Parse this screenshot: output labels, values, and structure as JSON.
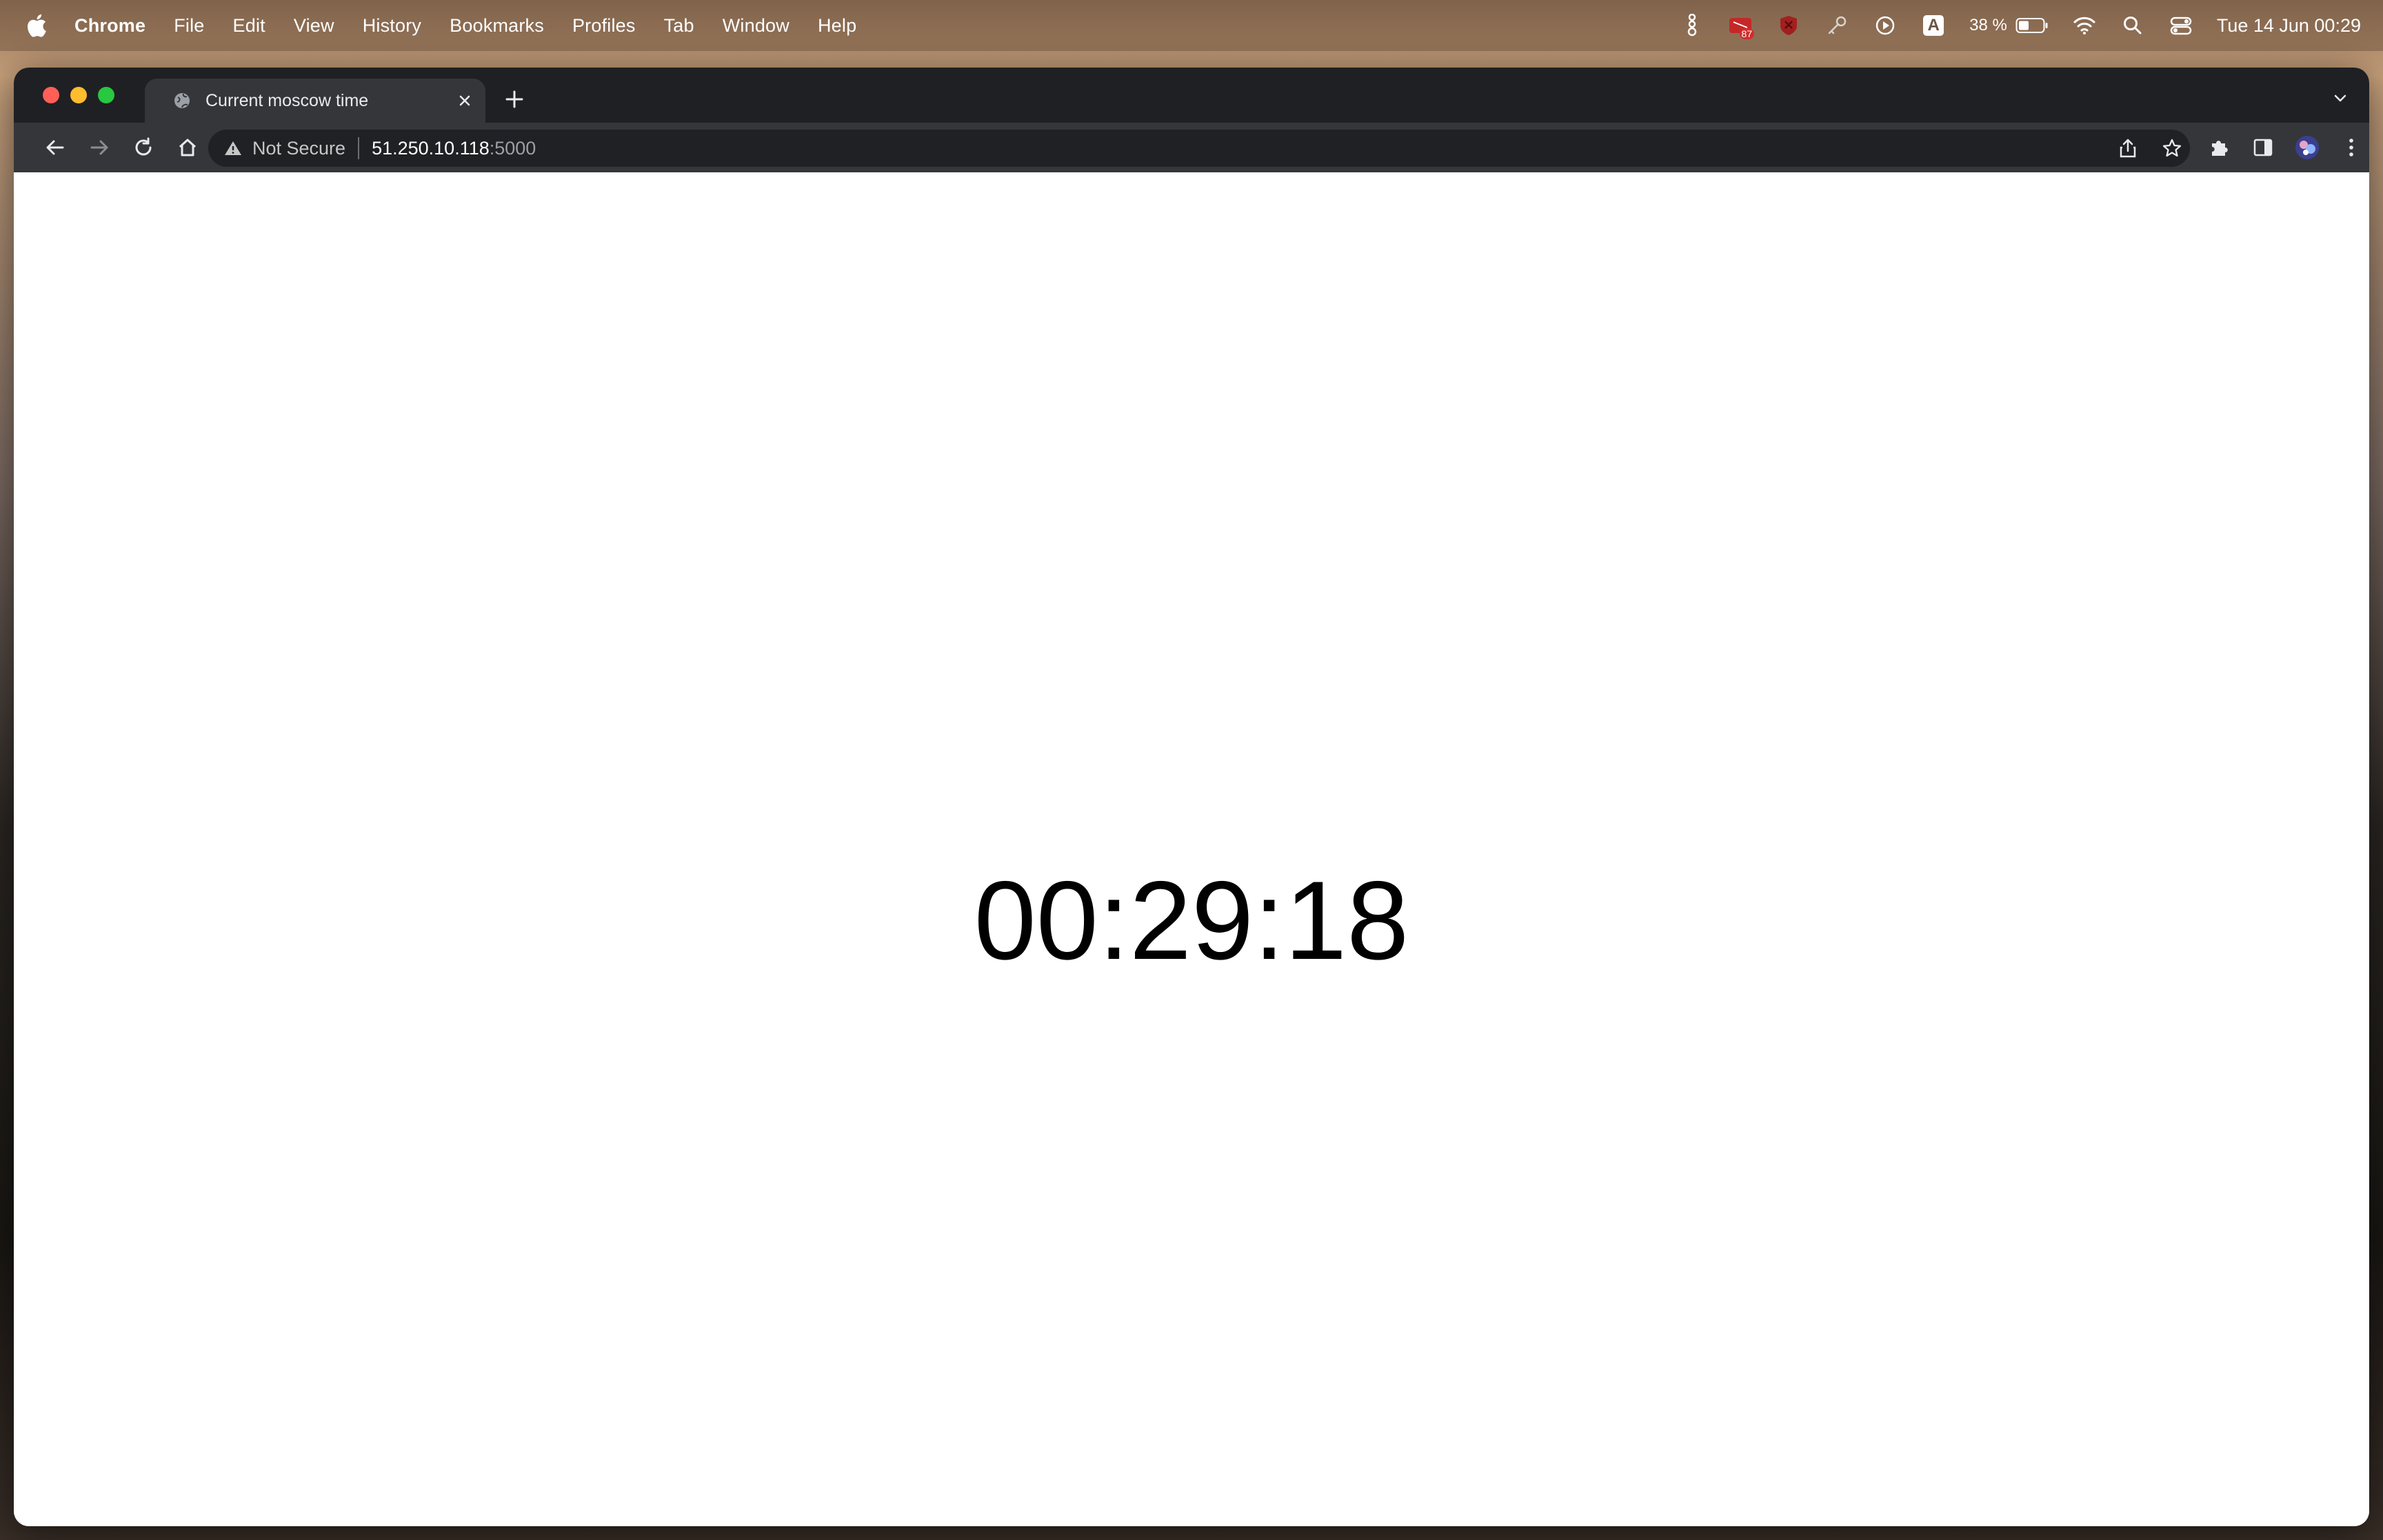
{
  "menubar": {
    "app_name": "Chrome",
    "items": [
      "File",
      "Edit",
      "View",
      "History",
      "Bookmarks",
      "Profiles",
      "Tab",
      "Window",
      "Help"
    ],
    "status": {
      "badge_count": "87",
      "battery_percent": "38 %",
      "datetime": "Tue 14 Jun  00:29",
      "input_source": "A"
    }
  },
  "browser": {
    "tab": {
      "title": "Current moscow time"
    },
    "omnibox": {
      "security_label": "Not Secure",
      "url_host": "51.250.10.118",
      "url_port": ":5000"
    }
  },
  "page": {
    "time": "00:29:18"
  },
  "colors": {
    "tabstrip": "#1f2023",
    "toolbar": "#35363a",
    "omnibox": "#202124",
    "close": "#ff5f57",
    "minimize": "#febc2e",
    "maximize": "#28c840"
  }
}
